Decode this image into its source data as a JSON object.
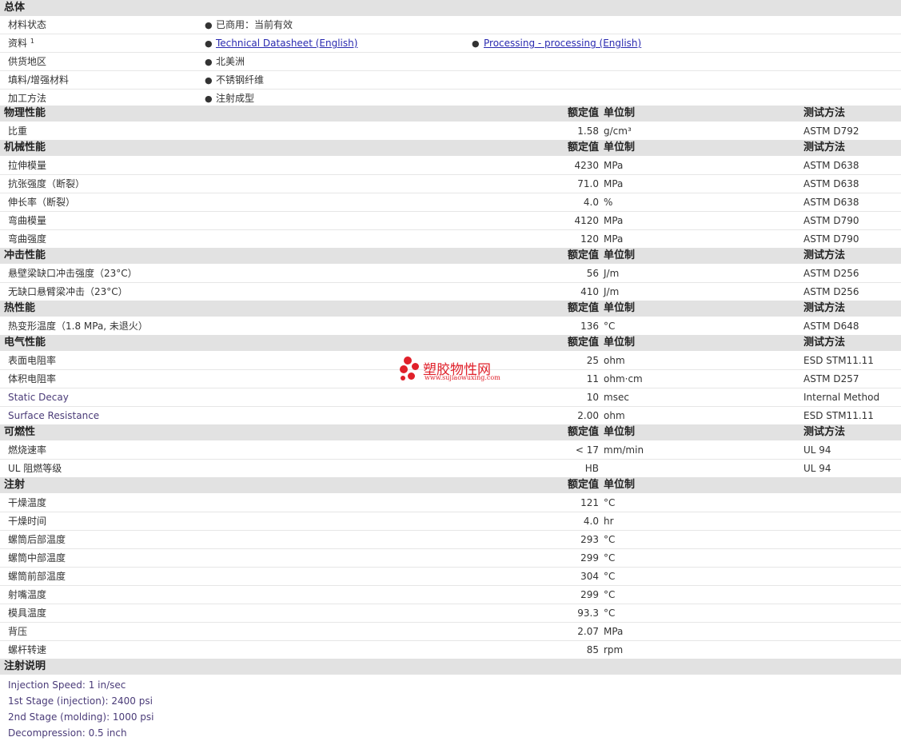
{
  "general": {
    "title": "总体",
    "rows": [
      {
        "label": "材料状态",
        "value": "已商用：当前有效"
      },
      {
        "label": "资料",
        "sup": "1",
        "link1": "Technical Datasheet (English)",
        "link2": "Processing - processing (English)"
      },
      {
        "label": "供货地区",
        "value": "北美洲"
      },
      {
        "label": "填料/增强材料",
        "value": "不锈钢纤维"
      },
      {
        "label": "加工方法",
        "value": "注射成型"
      }
    ]
  },
  "headers": {
    "nominal": "额定值",
    "unit": "单位制",
    "method": "测试方法"
  },
  "sections": {
    "physical": {
      "title": "物理性能",
      "rows": [
        {
          "label": "比重",
          "value": "1.58",
          "unit": "g/cm³",
          "method": "ASTM D792"
        }
      ]
    },
    "mechanical": {
      "title": "机械性能",
      "rows": [
        {
          "label": "拉伸模量",
          "value": "4230",
          "unit": "MPa",
          "method": "ASTM D638"
        },
        {
          "label": "抗张强度（断裂）",
          "value": "71.0",
          "unit": "MPa",
          "method": "ASTM D638"
        },
        {
          "label": "伸长率（断裂）",
          "value": "4.0",
          "unit": "%",
          "method": "ASTM D638"
        },
        {
          "label": "弯曲模量",
          "value": "4120",
          "unit": "MPa",
          "method": "ASTM D790"
        },
        {
          "label": "弯曲强度",
          "value": "120",
          "unit": "MPa",
          "method": "ASTM D790"
        }
      ]
    },
    "impact": {
      "title": "冲击性能",
      "rows": [
        {
          "label": "悬壁梁缺口冲击强度（23°C）",
          "value": "56",
          "unit": "J/m",
          "method": "ASTM D256"
        },
        {
          "label": "无缺口悬臂梁冲击（23°C）",
          "value": "410",
          "unit": "J/m",
          "method": "ASTM D256"
        }
      ]
    },
    "thermal": {
      "title": "热性能",
      "rows": [
        {
          "label": "热变形温度（1.8 MPa, 未退火）",
          "value": "136",
          "unit": "°C",
          "method": "ASTM D648"
        }
      ]
    },
    "electrical": {
      "title": "电气性能",
      "rows": [
        {
          "label": "表面电阻率",
          "value": "25",
          "unit": "ohm",
          "method": "ESD STM11.11"
        },
        {
          "label": "体积电阻率",
          "value": "11",
          "unit": "ohm·cm",
          "method": "ASTM D257"
        },
        {
          "label": "Static Decay",
          "value": "10",
          "unit": "msec",
          "method": "Internal Method",
          "eng": true
        },
        {
          "label": "Surface Resistance",
          "value": "2.00",
          "unit": "ohm",
          "method": "ESD STM11.11",
          "eng": true
        }
      ]
    },
    "flammability": {
      "title": "可燃性",
      "rows": [
        {
          "label": "燃烧速率",
          "value": "< 17",
          "unit": "mm/min",
          "method": "UL 94"
        },
        {
          "label": "UL 阻燃等级",
          "value": "HB",
          "unit": "",
          "method": "UL 94"
        }
      ]
    },
    "injection": {
      "title": "注射",
      "rows": [
        {
          "label": "干燥温度",
          "value": "121",
          "unit": "°C"
        },
        {
          "label": "干燥时间",
          "value": "4.0",
          "unit": "hr"
        },
        {
          "label": "螺筒后部温度",
          "value": "293",
          "unit": "°C"
        },
        {
          "label": "螺筒中部温度",
          "value": "299",
          "unit": "°C"
        },
        {
          "label": "螺筒前部温度",
          "value": "304",
          "unit": "°C"
        },
        {
          "label": "射嘴温度",
          "value": "299",
          "unit": "°C"
        },
        {
          "label": "模具温度",
          "value": "93.3",
          "unit": "°C"
        },
        {
          "label": "背压",
          "value": "2.07",
          "unit": "MPa"
        },
        {
          "label": "螺杆转速",
          "value": "85",
          "unit": "rpm"
        }
      ]
    }
  },
  "notes": {
    "title": "注射说明",
    "lines": [
      "Injection Speed: 1 in/sec",
      "1st Stage (injection): 2400 psi",
      "2nd Stage (molding): 1000 psi",
      "Decompression: 0.5 inch"
    ]
  },
  "watermark": {
    "name": "塑胶物性网",
    "url": "www.sujiaowuxing.com",
    "color": "#e0202a"
  }
}
